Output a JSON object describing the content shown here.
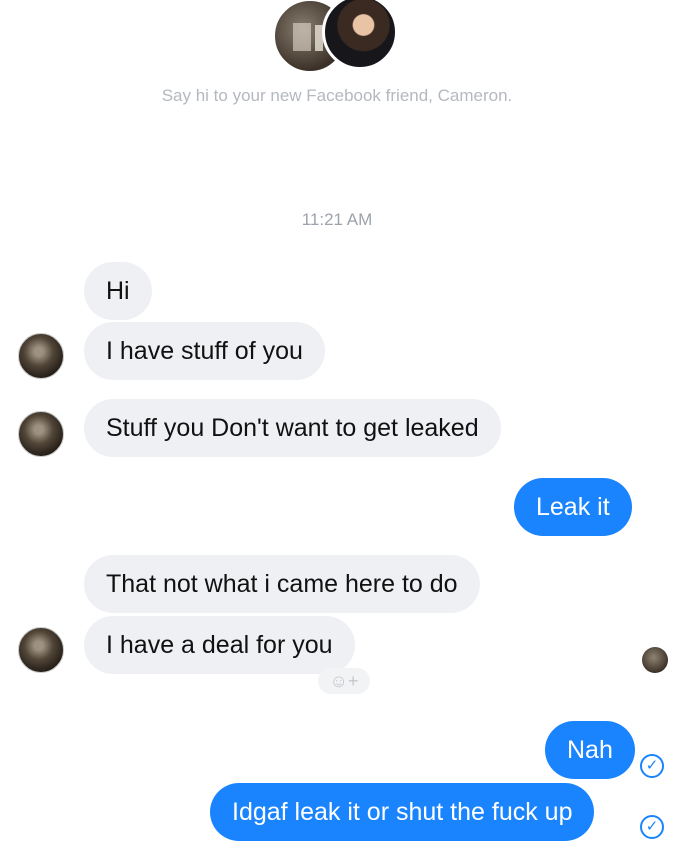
{
  "header": {
    "friend_note": "Say hi to your new Facebook friend, Cameron.",
    "avatars": [
      "contact-avatar",
      "user-avatar"
    ]
  },
  "timestamp": "11:21 AM",
  "messages": [
    {
      "direction": "incoming",
      "text": "Hi"
    },
    {
      "direction": "incoming",
      "text": "I have stuff of you"
    },
    {
      "direction": "incoming",
      "text": "Stuff you Don't want to get leaked"
    },
    {
      "direction": "outgoing",
      "text": "Leak it"
    },
    {
      "direction": "incoming",
      "text": "That not what i came here to do"
    },
    {
      "direction": "incoming",
      "text": "I have a deal for you"
    },
    {
      "direction": "outgoing",
      "text": "Nah"
    },
    {
      "direction": "outgoing",
      "text": "Idgaf leak it or shut the fuck up"
    }
  ],
  "reaction_button": "☺+",
  "status_icons": {
    "check": "✓",
    "color_outgoing": "#1a84ff",
    "color_incoming": "#eef0f3"
  }
}
